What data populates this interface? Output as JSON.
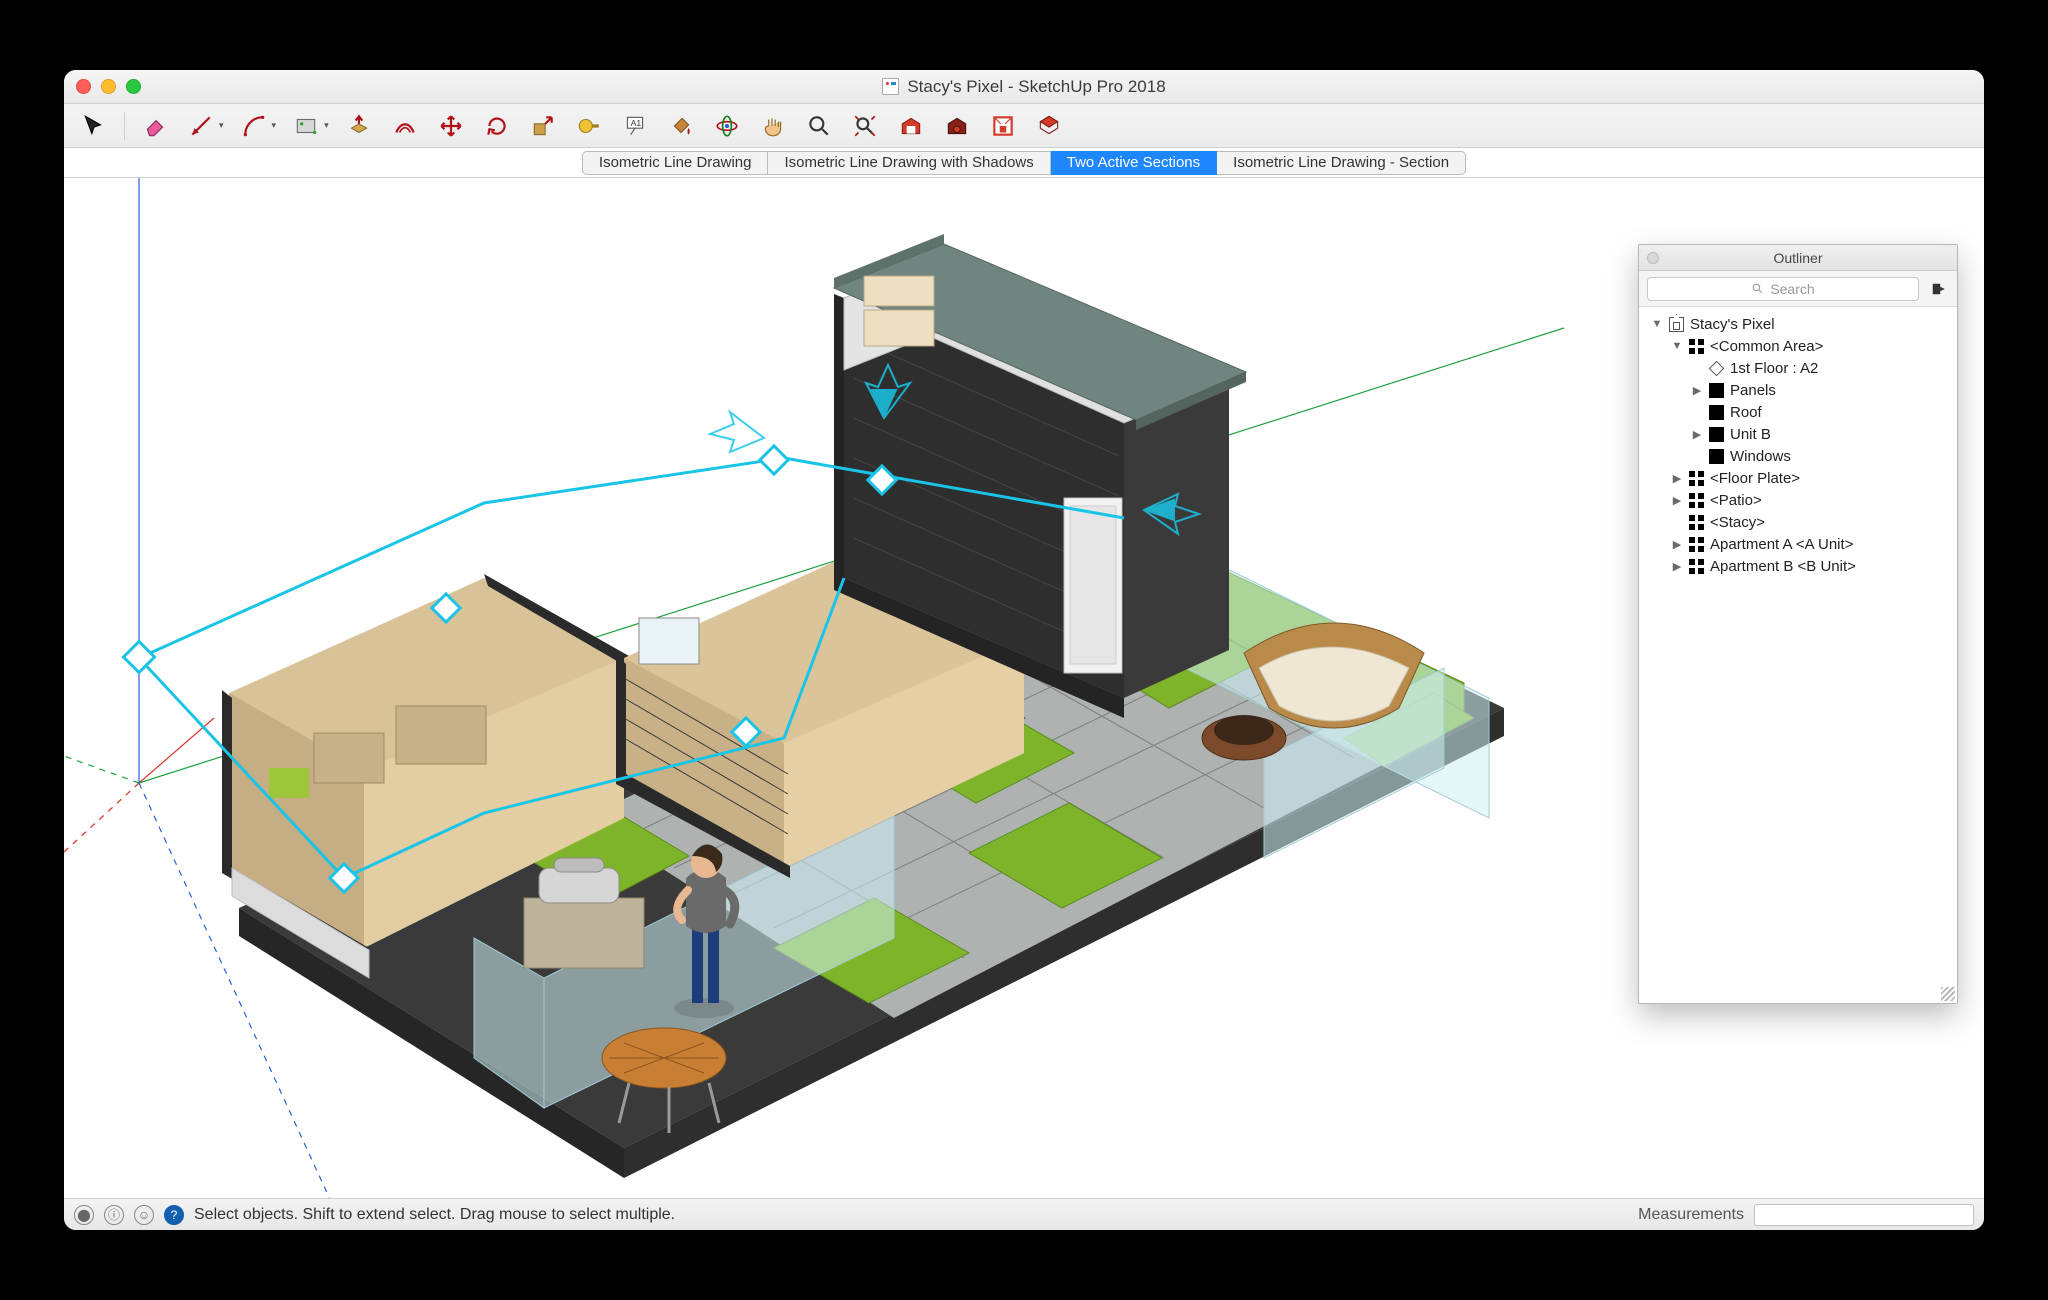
{
  "window": {
    "title": "Stacy's Pixel - SketchUp Pro 2018"
  },
  "toolbar": {
    "buttons": [
      {
        "name": "select",
        "title": "Select"
      },
      {
        "name": "eraser",
        "title": "Eraser"
      },
      {
        "name": "line",
        "title": "Line",
        "dropdown": true
      },
      {
        "name": "arc",
        "title": "Arc",
        "dropdown": true
      },
      {
        "name": "shape",
        "title": "Shapes",
        "dropdown": true
      },
      {
        "name": "pushpull",
        "title": "Push/Pull"
      },
      {
        "name": "offset",
        "title": "Offset"
      },
      {
        "name": "move",
        "title": "Move"
      },
      {
        "name": "rotate",
        "title": "Rotate"
      },
      {
        "name": "scale",
        "title": "Scale"
      },
      {
        "name": "tape",
        "title": "Tape Measure"
      },
      {
        "name": "text",
        "title": "Text"
      },
      {
        "name": "paint",
        "title": "Paint Bucket"
      },
      {
        "name": "orbit",
        "title": "Orbit"
      },
      {
        "name": "pan",
        "title": "Pan"
      },
      {
        "name": "zoom",
        "title": "Zoom"
      },
      {
        "name": "zoom-extents",
        "title": "Zoom Extents"
      },
      {
        "name": "warehouse3d",
        "title": "3D Warehouse"
      },
      {
        "name": "ext-warehouse",
        "title": "Extension Warehouse"
      },
      {
        "name": "layout",
        "title": "Send to LayOut"
      },
      {
        "name": "extensions",
        "title": "Extension Manager"
      }
    ]
  },
  "tabs": [
    {
      "label": "Isometric Line Drawing",
      "active": false
    },
    {
      "label": "Isometric Line Drawing with Shadows",
      "active": false
    },
    {
      "label": "Two Active Sections",
      "active": true
    },
    {
      "label": "Isometric Line Drawing - Section",
      "active": false
    }
  ],
  "outliner": {
    "title": "Outliner",
    "search_placeholder": "Search",
    "root": "Stacy's Pixel",
    "items": [
      {
        "depth": 0,
        "arrow": "down",
        "icon": "home",
        "label": "Stacy's Pixel"
      },
      {
        "depth": 1,
        "arrow": "down",
        "icon": "comp",
        "label": "<Common Area>"
      },
      {
        "depth": 2,
        "arrow": "blank",
        "icon": "section",
        "label": "1st Floor : A2"
      },
      {
        "depth": 2,
        "arrow": "right",
        "icon": "group",
        "label": "Panels"
      },
      {
        "depth": 2,
        "arrow": "blank",
        "icon": "group",
        "label": "Roof"
      },
      {
        "depth": 2,
        "arrow": "right",
        "icon": "group",
        "label": "Unit B"
      },
      {
        "depth": 2,
        "arrow": "blank",
        "icon": "group",
        "label": "Windows"
      },
      {
        "depth": 1,
        "arrow": "right",
        "icon": "comp",
        "label": "<Floor Plate>"
      },
      {
        "depth": 1,
        "arrow": "right",
        "icon": "comp",
        "label": "<Patio>"
      },
      {
        "depth": 1,
        "arrow": "blank",
        "icon": "comp",
        "label": "<Stacy>"
      },
      {
        "depth": 1,
        "arrow": "right",
        "icon": "comp",
        "label": "Apartment A <A Unit>"
      },
      {
        "depth": 1,
        "arrow": "right",
        "icon": "comp",
        "label": "Apartment B <B Unit>"
      }
    ]
  },
  "status": {
    "hint": "Select objects. Shift to extend select. Drag mouse to select multiple.",
    "measure_label": "Measurements"
  },
  "colors": {
    "accent": "#1e86ff",
    "axis_red": "#d9342b",
    "axis_green": "#1fa03c",
    "axis_blue": "#2a5fd9",
    "section_cyan": "#19c4e6",
    "grass": "#6fa61e",
    "grass2": "#8ec63f",
    "roof": "#6f827c",
    "wall_dark": "#2e2e2e",
    "wood": "#cdb083",
    "stone": "#9aa0a0",
    "glass": "#bfe8ef"
  }
}
